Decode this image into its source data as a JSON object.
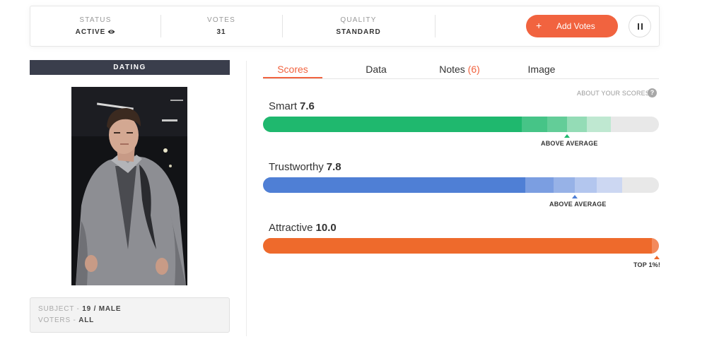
{
  "stats": {
    "status_label": "STATUS",
    "status_value": "ACTIVE",
    "votes_label": "VOTES",
    "votes_value": "31",
    "quality_label": "QUALITY",
    "quality_value": "STANDARD",
    "add_votes_label": "Add Votes",
    "add_votes_plus": "+",
    "accent_color": "#f1633f"
  },
  "photo": {
    "category_label": "DATING"
  },
  "subject": {
    "subject_key": "SUBJECT -",
    "subject_value": "19 / MALE",
    "voters_key": "VOTERS -",
    "voters_value": "ALL"
  },
  "tabs": {
    "scores": "Scores",
    "data": "Data",
    "notes": "Notes",
    "notes_count": "(6)",
    "image": "Image",
    "active": "Scores"
  },
  "about_scores": "ABOUT YOUR SCORES",
  "help_icon": "?",
  "scores": [
    {
      "name": "Smart",
      "value": "7.6",
      "badge": "ABOVE AVERAGE",
      "color": "#1fb86e"
    },
    {
      "name": "Trustworthy",
      "value": "7.8",
      "badge": "ABOVE AVERAGE",
      "color": "#4f7fd5"
    },
    {
      "name": "Attractive",
      "value": "10.0",
      "badge": "TOP 1%!",
      "color": "#ee6a2c"
    }
  ]
}
